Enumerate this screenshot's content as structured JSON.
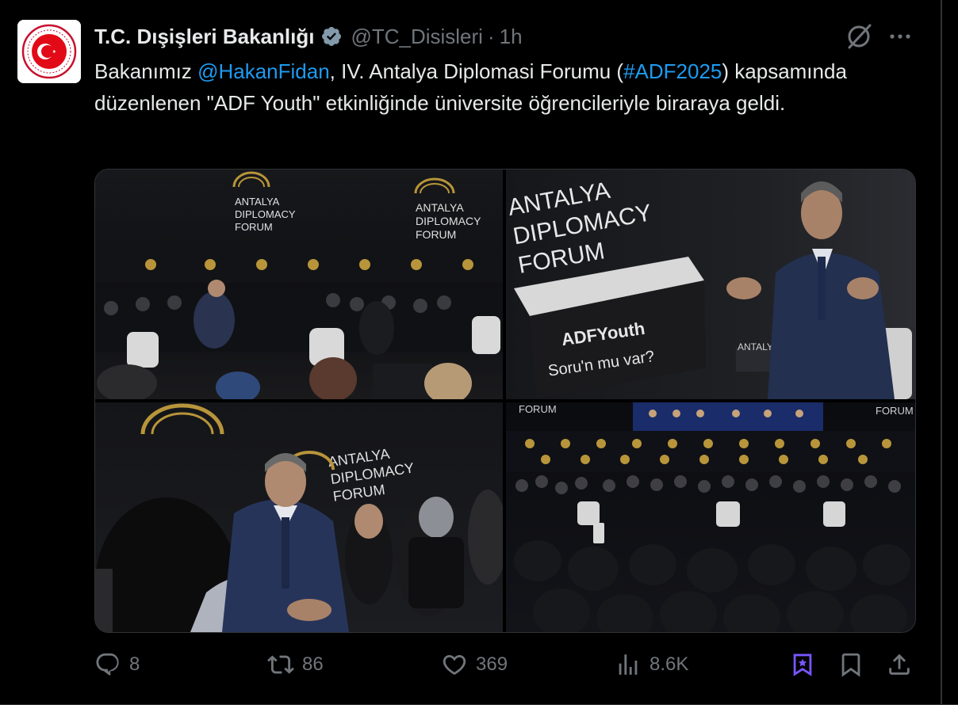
{
  "account": {
    "name": "T.C. Dışişleri Bakanlığı",
    "handle": "@TC_Disisleri",
    "separator": "·",
    "time": "1h"
  },
  "post": {
    "segments": [
      {
        "text": "Bakanımız ",
        "link": false
      },
      {
        "text": "@HakanFidan",
        "link": true
      },
      {
        "text": ", IV. Antalya Diplomasi Forumu (",
        "link": false
      },
      {
        "text": "#ADF2025",
        "link": true
      },
      {
        "text": ") kapsamında düzenlenen \"ADF Youth\" etkinliğinde üniversite öğrencileriyle biraraya geldi.",
        "link": false
      }
    ]
  },
  "media": {
    "photo1": {
      "logo_lines": [
        "ANTALYA",
        "DIPLOMACY",
        "FORUM"
      ],
      "small_logo": "ANTALYA DIPLOMACY FORUM"
    },
    "photo2": {
      "logo_lines": [
        "ANTALYA",
        "DIPLOMACY",
        "FORUM"
      ],
      "sign_title": "ADFYouth",
      "sign_subtitle": "Soru'n mu var?",
      "side_text": "ANTALYA"
    },
    "photo3": {
      "logo_lines": [
        "ANTALYA",
        "DIPLOMACY",
        "FORUM"
      ]
    },
    "photo4": {
      "label_left": "FORUM",
      "label_right": "FORUM"
    }
  },
  "actions": {
    "replies": "8",
    "reposts": "86",
    "likes": "369",
    "views": "8.6K"
  },
  "colors": {
    "background": "#000000",
    "text": "#e7e9ea",
    "muted": "#71767b",
    "link": "#1d9bf0",
    "verified": "#829aab",
    "grok_bookmark_accent": "#7856ff"
  }
}
